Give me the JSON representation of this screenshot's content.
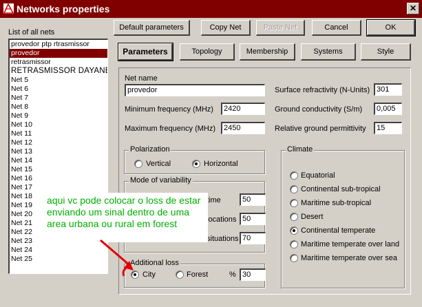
{
  "window": {
    "title": "Networks properties",
    "close_label": "✕"
  },
  "list": {
    "label": "List of all nets",
    "items": [
      "provedor ptp rtrasmissor",
      "provedor",
      "retrasmissor",
      "RETRASMISSOR DAYANE",
      "Net  5",
      "Net  6",
      "Net  7",
      "Net  8",
      "Net  9",
      "Net 10",
      "Net 11",
      "Net 12",
      "Net 13",
      "Net 14",
      "Net 15",
      "Net 16",
      "Net 17",
      "Net 18",
      "Net 19",
      "Net 20",
      "Net 21",
      "Net 22",
      "Net 23",
      "Net 24",
      "Net 25"
    ],
    "selected_index": 1
  },
  "buttons": {
    "default_params": "Default parameters",
    "copy_net": "Copy Net",
    "paste_net": "Paste Net",
    "cancel": "Cancel",
    "ok": "OK"
  },
  "tabs": [
    "Parameters",
    "Topology",
    "Membership",
    "Systems",
    "Style"
  ],
  "params": {
    "net_name_label": "Net name",
    "net_name_value": "provedor",
    "min_freq_label": "Minimum frequency (MHz)",
    "min_freq_value": "2420",
    "max_freq_label": "Maximum frequency (MHz)",
    "max_freq_value": "2450",
    "surface_refr_label": "Surface refractivity (N-Units)",
    "surface_refr_value": "301",
    "ground_cond_label": "Ground conductivity (S/m)",
    "ground_cond_value": "0,005",
    "rel_perm_label": "Relative ground permittivity",
    "rel_perm_value": "15"
  },
  "polarization": {
    "title": "Polarization",
    "vertical": "Vertical",
    "horizontal": "Horizontal",
    "selected": "horizontal"
  },
  "variability": {
    "title": "Mode of variability",
    "row1_label": "time",
    "row1_value": "50",
    "row2_label": "locations",
    "row2_value": "50",
    "row3_label": "situations",
    "row3_value": "70"
  },
  "additional_loss": {
    "title": "Additional loss",
    "city": "City",
    "forest": "Forest",
    "percent_label": "%",
    "value": "30",
    "selected": "city"
  },
  "climate": {
    "title": "Climate",
    "options": [
      "Equatorial",
      "Continental sub-tropical",
      "Maritime sub-tropical",
      "Desert",
      "Continental temperate",
      "Maritime temperate over land",
      "Maritime temperate over sea"
    ],
    "selected_index": 4
  },
  "annotation": {
    "text": "aqui vc pode colocar o  loss de estar enviando um sinal dentro de uma area urbana ou rural em forest",
    "color": "#00b000"
  },
  "colors": {
    "title_bar": "#800000",
    "selection": "#800000",
    "face": "#d4d0c8",
    "arrow": "#e00000"
  }
}
